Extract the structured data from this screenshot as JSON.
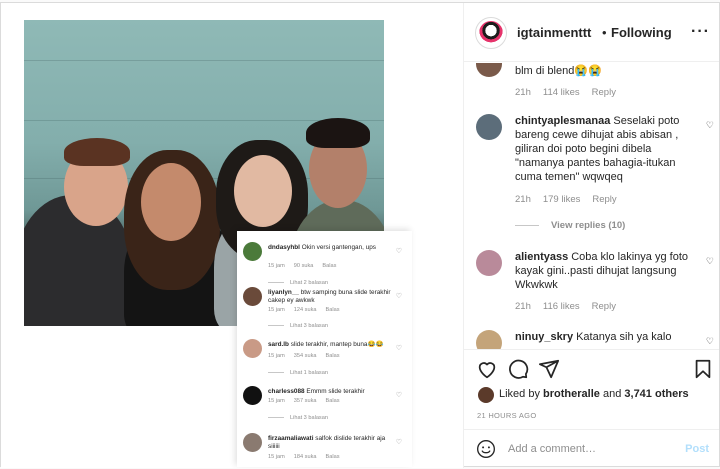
{
  "colors": {
    "link_disabled": "#b2dffc",
    "secondary_text": "#8e8e8e",
    "primary_text": "#262626"
  },
  "header": {
    "username": "igtainmenttt",
    "separator": "•",
    "follow_status": "Following",
    "more_icon": "more-horizontal-icon"
  },
  "comments": [
    {
      "username": "",
      "text": "blm di blend😭😭",
      "time": "21h",
      "likes": "114 likes",
      "reply": "Reply"
    },
    {
      "username": "chintyaplesmanaa",
      "text": "Seselaki poto bareng cewe dihujat abis abisan , giliran doi poto begini dibela \"namanya pantes bahagia-itukan cuma temen\" wqwqeq",
      "time": "21h",
      "likes": "179 likes",
      "reply": "Reply",
      "view_replies": "View replies (10)"
    },
    {
      "username": "alientyass",
      "text": "Coba klo lakinya yg foto kayak gini..pasti dihujat langsung Wkwkwk",
      "time": "21h",
      "likes": "116 likes",
      "reply": "Reply"
    },
    {
      "username": "ninuy_skry",
      "text": "Katanya sih ya kalo"
    }
  ],
  "actions": {
    "like_icon": "heart-icon",
    "comment_icon": "comment-icon",
    "share_icon": "paper-plane-icon",
    "save_icon": "bookmark-icon",
    "liked_prefix": "Liked by",
    "liked_user": "brotheralle",
    "liked_and": "and",
    "liked_count": "3,741 others",
    "timestamp": "21 HOURS AGO"
  },
  "add_comment": {
    "placeholder": "Add a comment…",
    "post_label": "Post",
    "emoji_icon": "smile-icon"
  },
  "screenshot_comments": [
    {
      "username": "dndasyhbl",
      "text": "Okin versi gantengan, ups",
      "time": "15 jam",
      "likes": "90 suka",
      "reply": "Balas",
      "replies": "Lihat 2 balasan"
    },
    {
      "username": "liyanlyn__",
      "text": "btw samping buna slide terakhir cakep ey awkwk",
      "time": "15 jam",
      "likes": "124 suka",
      "reply": "Balas",
      "replies": "Lihat 3 balasan"
    },
    {
      "username": "sard.lb",
      "text": "slide terakhir, mantep buna😂😂",
      "time": "15 jam",
      "likes": "354 suka",
      "reply": "Balas",
      "replies": "Lihat 1 balasan"
    },
    {
      "username": "charless088",
      "text": "Emmm slide terakhir",
      "time": "15 jam",
      "likes": "357 suka",
      "reply": "Balas",
      "replies": "Lihat 3 balasan"
    },
    {
      "username": "firzaamaliawati",
      "text": "salfok dislide terakhir aja siiiiii",
      "time": "15 jam",
      "likes": "184 suka",
      "reply": "Balas"
    }
  ]
}
